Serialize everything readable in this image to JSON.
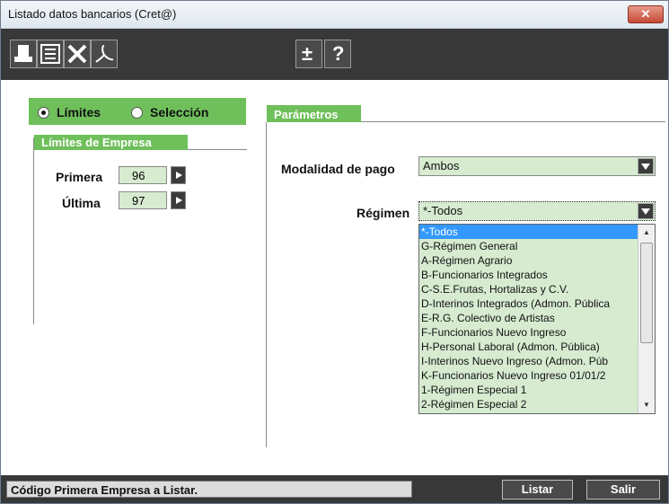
{
  "window": {
    "title": "Listado datos bancarios (Cret@)",
    "close_glyph": "✕"
  },
  "toolbar": {
    "buttons": [
      "print-icon",
      "list-icon",
      "excel-icon",
      "pdf-icon",
      "plus-minus-icon",
      "help-icon"
    ],
    "plus_minus_glyph": "±",
    "help_glyph": "?"
  },
  "mode": {
    "limits_label": "Límites",
    "selection_label": "Selección",
    "selected": "Límites"
  },
  "company_limits": {
    "header": "Límites de Empresa",
    "first_label": "Primera",
    "first_value": "96",
    "last_label": "Última",
    "last_value": "97"
  },
  "parameters": {
    "tab_label": "Parámetros",
    "payment_label": "Modalidad de pago",
    "payment_value": "Ambos",
    "regime_label": "Régimen",
    "regime_value": "*-Todos",
    "regime_options": [
      "*-Todos",
      "G-Régimen General",
      "A-Régimen Agrario",
      "B-Funcionarios Integrados",
      "C-S.E.Frutas, Hortalizas y C.V.",
      "D-Interinos Integrados (Admon. Pública",
      "E-R.G. Colectivo de Artistas",
      "F-Funcionarios Nuevo Ingreso",
      "H-Personal Laboral (Admon. Pública)",
      "I-Interinos Nuevo Ingreso (Admon. Púb",
      "K-Funcionarios Nuevo Ingreso 01/01/2",
      "1-Régimen Especial 1",
      "2-Régimen Especial 2"
    ]
  },
  "status": {
    "text": "Código Primera Empresa a Listar."
  },
  "actions": {
    "list_label": "Listar",
    "exit_label": "Salir"
  },
  "colors": {
    "accent_green": "#6fbf5b",
    "field_green": "#d6ebd0",
    "dark_bar": "#383838"
  }
}
